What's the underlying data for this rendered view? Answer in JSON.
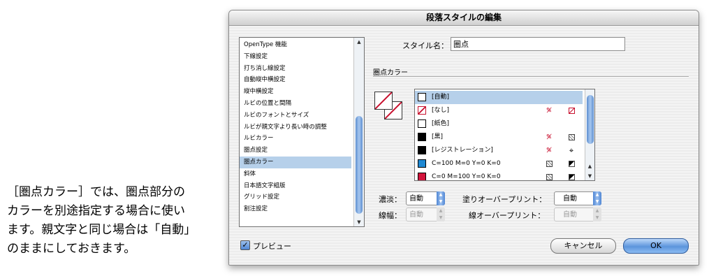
{
  "caption": {
    "lines": [
      "［圏点カラー］では、圏点部分の",
      "カラーを別途指定する場合に使い",
      "ます。親文字と同じ場合は「自動」",
      "のままにしておきます。"
    ]
  },
  "dialog": {
    "title": "段落スタイルの編集",
    "categories": [
      "OpenType 機能",
      "下線設定",
      "打ち消し線設定",
      "自動縦中横設定",
      "縦中横設定",
      "ルビの位置と間隔",
      "ルビのフォントとサイズ",
      "ルビが親文字より長い時の調整",
      "ルビカラー",
      "圏点設定",
      "圏点カラー",
      "斜体",
      "日本語文字組版",
      "グリッド設定",
      "割注設定"
    ],
    "selected_category": "圏点カラー",
    "style_name_label": "スタイル名：",
    "style_name_value": "圏点",
    "section_title": "圏点カラー",
    "swatches": [
      {
        "name": "[自動]",
        "color": "#ffffff",
        "icon1": "",
        "icon2": ""
      },
      {
        "name": "[なし]",
        "color": "none",
        "icon1": "no-edit",
        "icon2": "none"
      },
      {
        "name": "[紙色]",
        "color": "#ffffff",
        "icon1": "",
        "icon2": ""
      },
      {
        "name": "[黒]",
        "color": "#000000",
        "icon1": "no-edit",
        "icon2": "process"
      },
      {
        "name": "[レジストレーション]",
        "color": "#000000",
        "icon1": "no-edit",
        "icon2": "registration"
      },
      {
        "name": "C=100 M=0 Y=0 K=0",
        "color": "#1e88d2",
        "icon1": "process",
        "icon2": "cmyk"
      },
      {
        "name": "C=0 M=100 Y=0 K=0",
        "color": "#d2143c",
        "icon1": "process",
        "icon2": "cmyk"
      }
    ],
    "selected_swatch": "[自動]",
    "tint_label": "濃淡：",
    "tint_value": "自動",
    "fill_overprint_label": "塗りオーバープリント：",
    "fill_overprint_value": "自動",
    "weight_label": "線幅：",
    "weight_value": "自動",
    "stroke_overprint_label": "線オーバープリント：",
    "stroke_overprint_value": "自動",
    "preview_label": "プレビュー",
    "preview_checked": true,
    "cancel_label": "キャンセル",
    "ok_label": "OK"
  }
}
